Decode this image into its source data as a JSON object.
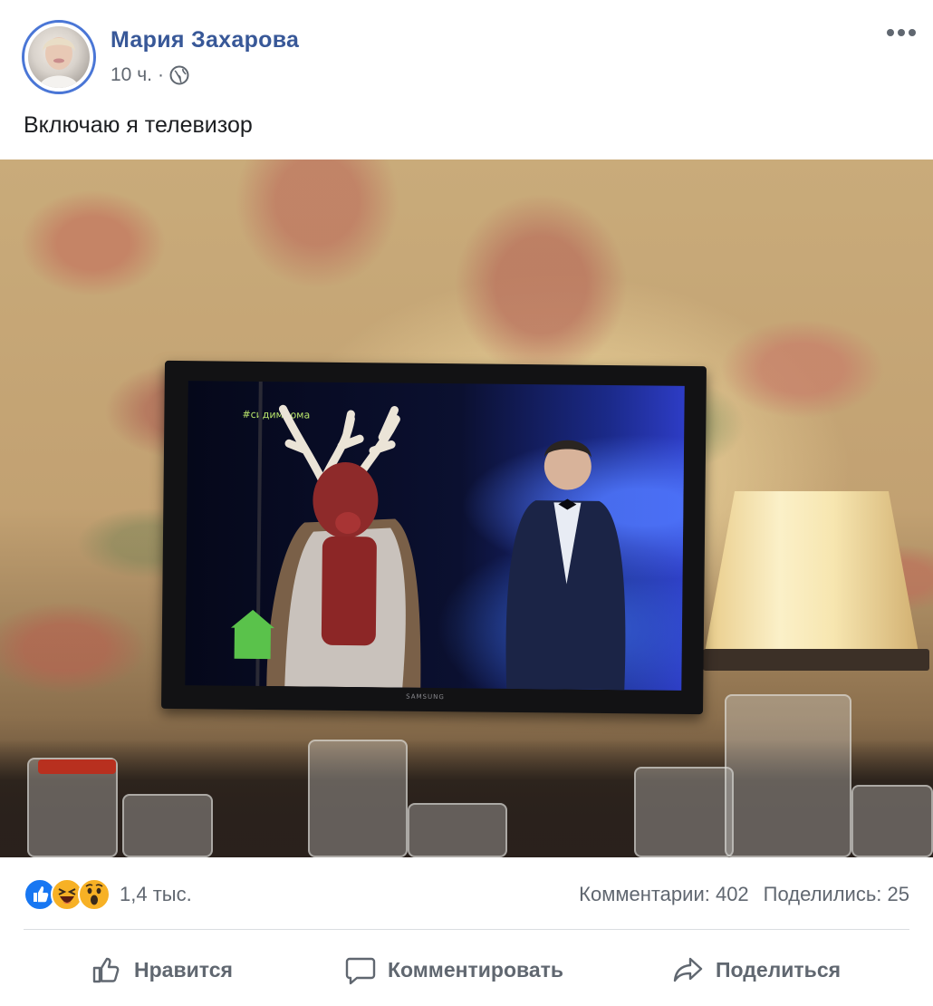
{
  "post": {
    "author": "Мария Захарова",
    "time": "10 ч.",
    "text": "Включаю я телевизор",
    "photo": {
      "tv_hashtag": "#сидимдома",
      "tv_brand": "SAMSUNG"
    }
  },
  "stats": {
    "reactions_count": "1,4 тыс.",
    "comments": "Комментарии: 402",
    "shares": "Поделились: 25"
  },
  "actions": {
    "like": "Нравится",
    "comment": "Комментировать",
    "share": "Поделиться"
  },
  "icons": {
    "more": "more-icon",
    "privacy": "globe-icon",
    "reactions": [
      "like-reaction-icon",
      "haha-reaction-icon",
      "wow-reaction-icon"
    ]
  },
  "colors": {
    "author_link": "#385898",
    "secondary_text": "#606770",
    "like_blue": "#1877f2",
    "emoji_yellow": "#f7b125"
  }
}
